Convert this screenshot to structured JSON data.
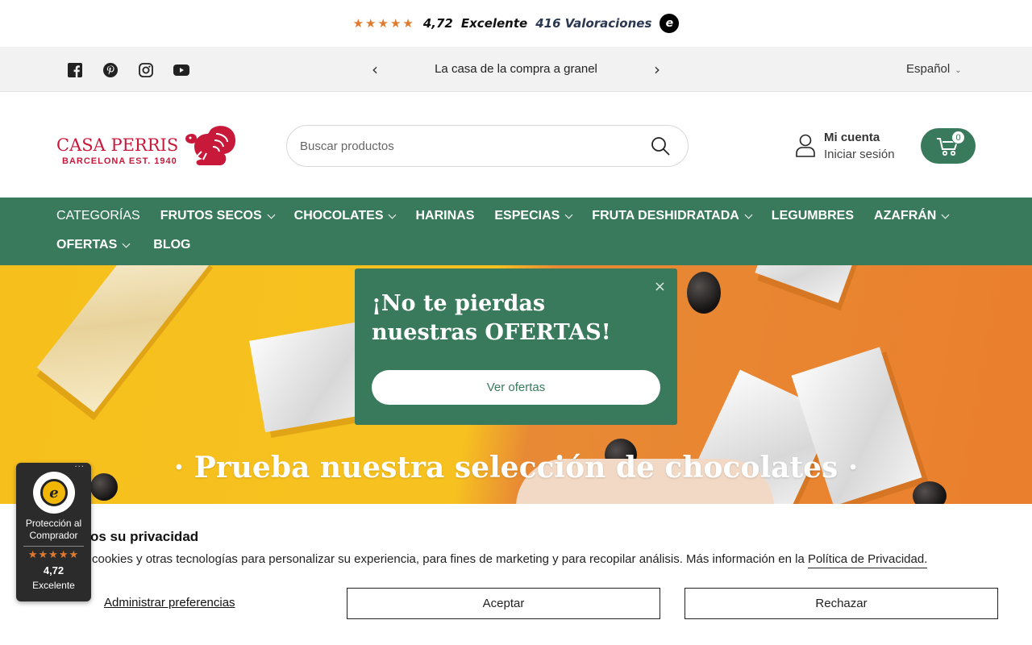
{
  "rating_bar": {
    "stars": "★★★★★",
    "score": "4,72",
    "label": "Excelente",
    "reviews": "416 Valoraciones",
    "badge_icon": "trusted-shops-icon",
    "badge_letter": "e"
  },
  "announcement": {
    "social_icons": [
      "facebook-icon",
      "pinterest-icon",
      "instagram-icon",
      "youtube-icon"
    ],
    "message": "La casa de la compra a granel",
    "prev": "‹",
    "next": "›",
    "language": "Español"
  },
  "header": {
    "logo": {
      "brand": "CASA PERRIS",
      "subtitle": "BARCELONA EST. 1940"
    },
    "search": {
      "placeholder": "Buscar productos"
    },
    "account": {
      "title": "Mi cuenta",
      "subtitle": "Iniciar sesión"
    },
    "cart": {
      "count": "0"
    }
  },
  "nav": {
    "row1": [
      {
        "label": "CATEGORÍAS",
        "dropdown": false
      },
      {
        "label": "FRUTOS SECOS",
        "dropdown": true
      },
      {
        "label": "CHOCOLATES",
        "dropdown": true
      },
      {
        "label": "HARINAS",
        "dropdown": false
      },
      {
        "label": "ESPECIAS",
        "dropdown": true
      },
      {
        "label": "FRUTA DESHIDRATADA",
        "dropdown": true
      },
      {
        "label": "LEGUMBRES",
        "dropdown": false
      },
      {
        "label": "AZAFRÁN",
        "dropdown": true
      }
    ],
    "row2": [
      {
        "label": "OFERTAS",
        "dropdown": true
      },
      {
        "label": "BLOG",
        "dropdown": false
      }
    ]
  },
  "hero": {
    "title": "· Prueba nuestra selección de chocolates ·",
    "colors": {
      "left": "#f7c220",
      "right": "#ea7f2d"
    }
  },
  "popup": {
    "title": "¡No te pierdas nuestras OFERTAS!",
    "button": "Ver ofertas",
    "close": "×"
  },
  "cookie": {
    "title": "os su privacidad",
    "text": "cookies y otras tecnologías para personalizar su experiencia, para fines de marketing y para recopilar análisis. Más información en la ",
    "link": "Política de Privacidad.",
    "manage": "Administrar preferencias",
    "accept": "Aceptar",
    "reject": "Rechazar"
  },
  "trust_badge": {
    "menu": "···",
    "seal_letter": "e",
    "protection": "Protección al Comprador",
    "stars": "★★★★★",
    "score": "4,72",
    "label": "Excelente"
  },
  "colors": {
    "brand_green": "#3a7a5c",
    "brand_red": "#c8193b",
    "star_orange": "#e07a2e"
  }
}
